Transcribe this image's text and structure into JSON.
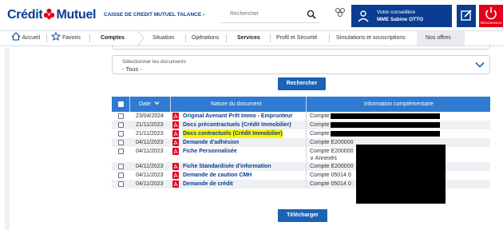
{
  "brand": {
    "part1": "Crédit",
    "part2": "Mutuel"
  },
  "header": {
    "caisse": "CAISSE DE CREDIT MUTUEL TALANCE ›",
    "search_placeholder": "Rechercher",
    "advisor_line1": "Votre conseillère",
    "advisor_line2": "MME Sabine OTTO",
    "logout_label": "Déconnexion"
  },
  "nav": {
    "accueil": "Accueil",
    "favoris": "Favoris",
    "comptes": "Comptes",
    "items": [
      "Situation",
      "Opérations",
      "Services",
      "Profil et Sécurité",
      "Simulations et souscriptions",
      "Nos offres"
    ]
  },
  "filter": {
    "label": "Sélectionner les documents",
    "value": "- Tous -",
    "search_button": "Rechercher"
  },
  "table": {
    "headers": {
      "date": "Date",
      "nature": "Nature du document",
      "info": "Information complémentaire"
    },
    "rows": [
      {
        "date": "23/04/2024",
        "doc": "Original Avenant Prêt Immo - Emprunteur",
        "info": "Compte"
      },
      {
        "date": "21/11/2023",
        "doc": "Docs précontractuels (Crédit Immobilier)",
        "info": "Compte"
      },
      {
        "date": "21/11/2023",
        "doc": "Docs contractuels (Crédit Immobilier)",
        "info": "Compte"
      },
      {
        "date": "04/11/2023",
        "doc": "Demande d'adhésion",
        "info": "Compte E200000"
      },
      {
        "date": "04/11/2023",
        "doc": "Fiche Personnalisée",
        "info": "Compte E200000",
        "extra": "∨ Annexés"
      },
      {
        "date": "04/11/2023",
        "doc": "Fiche Standardisée d'information",
        "info": "Compte E200000"
      },
      {
        "date": "04/11/2023",
        "doc": "Demande de caution CMH",
        "info": "Compte 05014 0"
      },
      {
        "date": "04/11/2023",
        "doc": "Demande de crédit",
        "info": "Compte 05014 0"
      }
    ]
  },
  "download_button": "Télécharger",
  "colors": {
    "primary": "#0a3d91",
    "accent": "#2f7bd1",
    "red": "#e2001a",
    "highlight": "#fff400"
  }
}
